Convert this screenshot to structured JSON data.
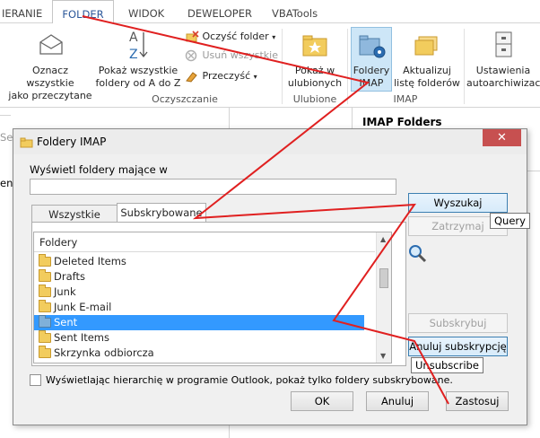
{
  "ribbon": {
    "tabs": [
      {
        "label": "IERANIE"
      },
      {
        "label": "FOLDER"
      },
      {
        "label": "WIDOK"
      },
      {
        "label": "DEWELOPER"
      },
      {
        "label": "VBATools"
      }
    ],
    "buttons": {
      "mark_all_read": "Oznacz wszystkie\njako przeczytane",
      "show_all_az": "Pokaż wszystkie\nfoldery od A do Z",
      "clean_folder": "Oczyść folder",
      "delete_all": "Usuń wszystkie",
      "move": "Przeczyść",
      "show_in_favorites": "Pokaż w\nulubionych",
      "imap_folders": "Foldery\nIMAP",
      "update_folder_list": "Aktualizuj\nlistę folderów",
      "autoarchive": "Ustawienia\nautoarchiwizacji"
    },
    "groups": {
      "cleanup": "Oczyszczanie",
      "favorites": "Ulubione",
      "imap": "IMAP"
    },
    "imap_tooltip_title": "IMAP Folders"
  },
  "behind": {
    "left_letters_1": "Se",
    "left_letters_2": "en"
  },
  "dialog": {
    "title": "Foldery IMAP",
    "close": "✕",
    "filter_label": "Wyświetl foldery mające w",
    "filter_value": "",
    "tabs": {
      "all": "Wszystkie",
      "subscribed": "Subskrybowane"
    },
    "list_header": "Foldery",
    "folders": [
      {
        "name": "Deleted Items"
      },
      {
        "name": "Drafts"
      },
      {
        "name": "Junk"
      },
      {
        "name": "Junk E-mail"
      },
      {
        "name": "Sent",
        "selected": true
      },
      {
        "name": "Sent Items"
      },
      {
        "name": "Skrzynka odbiorcza"
      }
    ],
    "buttons": {
      "search": "Wyszukaj",
      "stop": "Zatrzymaj",
      "subscribe": "Subskrybuj",
      "unsubscribe": "Anuluj subskrypcję",
      "ok": "OK",
      "cancel": "Anuluj",
      "apply": "Zastosuj"
    },
    "checkbox_label": "Wyświetlając hierarchię w programie Outlook, pokaż tylko foldery subskrybowane.",
    "checkbox_checked": false,
    "tooltip_query": "Query",
    "tooltip_unsubscribe": "Unsubscribe"
  },
  "colors": {
    "accent": "#2b579a",
    "selection": "#3399ff",
    "annotation": "#e02020",
    "close": "#c75050"
  }
}
